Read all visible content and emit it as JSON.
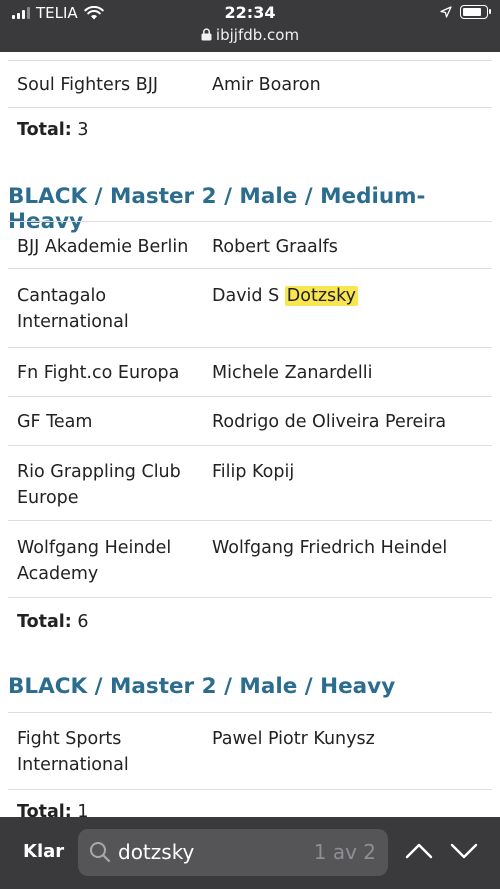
{
  "status_bar": {
    "carrier": "TELIA",
    "time": "22:34",
    "url": "ibjjfdb.com",
    "battery_level": 0.85
  },
  "top_partial": {
    "row": {
      "team": "Soul Fighters BJJ",
      "name": "Amir Boaron"
    },
    "total_label": "Total:",
    "total_value": "3"
  },
  "division1": {
    "title": "BLACK / Master 2 / Male / Medium-Heavy",
    "rows": [
      {
        "team": "BJJ Akademie Berlin",
        "name": "Robert Graalfs"
      },
      {
        "team": "Cantagalo International",
        "name_prefix": "David S",
        "name_highlight": "Dotzsky"
      },
      {
        "team": "Fn Fight.co Europa",
        "name": "Michele Zanardelli"
      },
      {
        "team": "GF Team",
        "name": "Rodrigo de Oliveira Pereira"
      },
      {
        "team": "Rio Grappling Club Europe",
        "name": "Filip Kopij"
      },
      {
        "team": "Wolfgang Heindel Academy",
        "name": "Wolfgang Friedrich Heindel"
      }
    ],
    "total_label": "Total:",
    "total_value": "6"
  },
  "division2": {
    "title": "BLACK / Master 2 / Male / Heavy",
    "rows": [
      {
        "team": "Fight Sports International",
        "name": "Pawel Piotr Kunysz"
      }
    ],
    "total_label": "Total:",
    "total_value": "1"
  },
  "find_bar": {
    "done_label": "Klar",
    "query": "dotzsky",
    "match_count": "1 av 2"
  },
  "icons": [
    "signal-icon",
    "wifi-icon",
    "lock-icon",
    "location-arrow-icon",
    "battery-icon",
    "search-icon",
    "chevron-up-icon",
    "chevron-down-icon"
  ],
  "colors": {
    "heading": "#2c6d8f",
    "highlight": "#f8e54f",
    "bar_bg": "#3a3a3c"
  }
}
